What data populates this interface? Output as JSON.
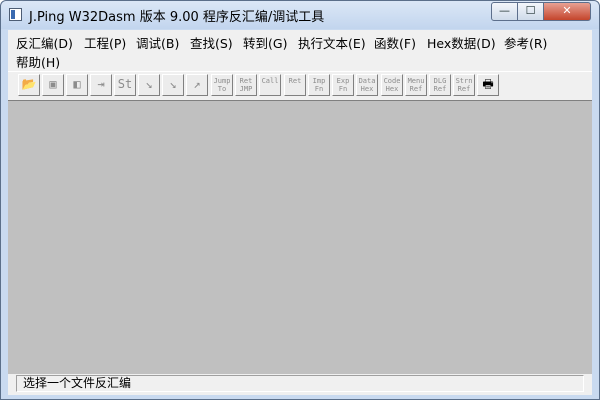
{
  "window": {
    "title": "J.Ping W32Dasm 版本 9.00 程序反汇编/调试工具",
    "controls": {
      "minimize": "—",
      "maximize": "☐",
      "close": "✕"
    }
  },
  "menu": [
    {
      "label": "反汇编(D)"
    },
    {
      "label": "工程(P)"
    },
    {
      "label": "调试(B)"
    },
    {
      "label": "查找(S)"
    },
    {
      "label": "转到(G)"
    },
    {
      "label": "执行文本(E)"
    },
    {
      "label": "函数(F)"
    },
    {
      "label": "Hex数据(D)"
    },
    {
      "label": "参考(R)"
    },
    {
      "label": "帮助(H)"
    }
  ],
  "toolbar": [
    {
      "name": "open-file-button",
      "icon": "folder-open-icon",
      "glyph": "📂",
      "enabled": true
    },
    {
      "name": "save-project-button",
      "icon": "save-icon",
      "glyph": "▣",
      "enabled": false
    },
    {
      "name": "disassemble-button",
      "icon": "magnify-icon",
      "glyph": "◧",
      "enabled": false
    },
    {
      "name": "load-process-button",
      "icon": "step-icon",
      "glyph": "⇥",
      "enabled": false
    },
    {
      "name": "goto-code-start-button",
      "icon": "code-start-icon",
      "text": "St",
      "enabled": false
    },
    {
      "name": "goto-program-entry-button",
      "icon": "entry-icon",
      "text": "↘",
      "enabled": false
    },
    {
      "name": "goto-page-button",
      "icon": "page-icon",
      "text": "↘",
      "enabled": false
    },
    {
      "name": "goto-offset-button",
      "icon": "offset-icon",
      "text": "↗",
      "enabled": false
    },
    {
      "name": "jump-to-button",
      "text": "Jump To",
      "enabled": false
    },
    {
      "name": "return-from-jump-button",
      "text": "Ret JMP",
      "enabled": false
    },
    {
      "name": "call-button",
      "text": "Call",
      "enabled": false
    },
    {
      "name": "return-from-call-button",
      "text": "Ret",
      "enabled": false
    },
    {
      "name": "imported-functions-button",
      "text": "Imp Fn",
      "enabled": false
    },
    {
      "name": "exported-functions-button",
      "text": "Exp Fn",
      "enabled": false
    },
    {
      "name": "data-hex-button",
      "text": "Data Hex",
      "enabled": false
    },
    {
      "name": "code-hex-button",
      "text": "Code Hex",
      "enabled": false
    },
    {
      "name": "menu-references-button",
      "text": "Menu Ref",
      "enabled": false
    },
    {
      "name": "dialog-references-button",
      "text": "DLG Ref",
      "enabled": false
    },
    {
      "name": "string-references-button",
      "text": "Strn Ref",
      "enabled": false
    },
    {
      "name": "print-button",
      "icon": "printer-icon",
      "glyph": "🖶",
      "enabled": true
    }
  ],
  "status": {
    "text": "选择一个文件反汇编"
  }
}
